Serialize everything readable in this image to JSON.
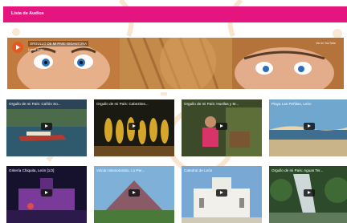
{
  "header": {
    "title": "Lista de Audios"
  },
  "featured": {
    "title": "ORGULLO DE MI PAIS: GIGANTONA",
    "subtitle": "Lahar Ilokz",
    "link": "Ver en YouTube"
  },
  "videos": [
    {
      "title": "Orgullo de mi País: Cañón So..."
    },
    {
      "title": "Orgullo de mi País: Cabezitos..."
    },
    {
      "title": "Orgullo de mi País: Huellas y M..."
    },
    {
      "title": "Playa Las Peñitas, León"
    },
    {
      "title": "Gritería Chiquita, León [1/2]"
    },
    {
      "title": "Volcán Momotombo, Lo Per..."
    },
    {
      "title": "Catedral de León"
    },
    {
      "title": "Orgullo de mi País: Aguas Ter..."
    }
  ],
  "colors": {
    "accent": "#e5157f",
    "play_accent": "#e8571d"
  }
}
